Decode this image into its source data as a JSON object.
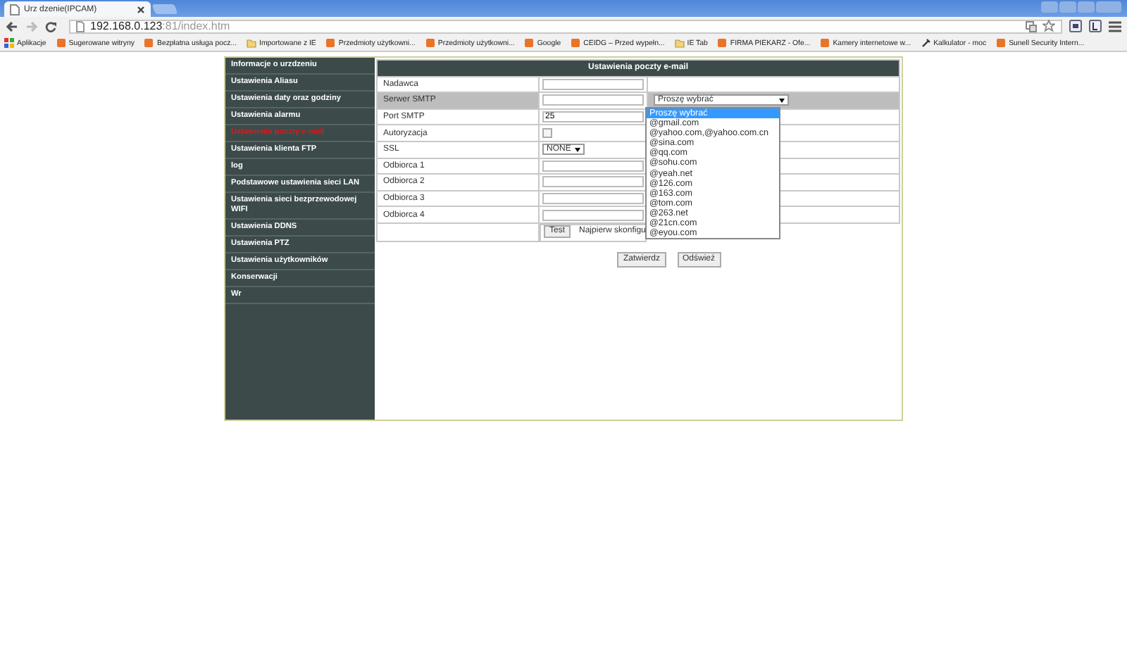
{
  "browser": {
    "tab_title": "Urz dzenie(IPCAM)",
    "url_host": "192.168.0.123",
    "url_rest": ":81/index.htm",
    "bookmarks": [
      {
        "kind": "apps",
        "label": "Aplikacje"
      },
      {
        "kind": "site",
        "label": "Sugerowane witryny"
      },
      {
        "kind": "site",
        "label": "Bezpłatna usługa pocz..."
      },
      {
        "kind": "folder",
        "label": "Importowane z IE"
      },
      {
        "kind": "site",
        "label": "Przedmioty użytkowni..."
      },
      {
        "kind": "site",
        "label": "Przedmioty użytkowni..."
      },
      {
        "kind": "site",
        "label": "Google"
      },
      {
        "kind": "site",
        "label": "CEIDG – Przed wypełn..."
      },
      {
        "kind": "folder",
        "label": "IE Tab"
      },
      {
        "kind": "site",
        "label": "FIRMA PIEKARZ - Ofe..."
      },
      {
        "kind": "site",
        "label": "Kamery internetowe w..."
      },
      {
        "kind": "tool",
        "label": "Kalkulator - moc"
      },
      {
        "kind": "site",
        "label": "Sunell Security Intern..."
      }
    ]
  },
  "sidebar": {
    "items": [
      {
        "label": "Informacje o urzdzeniu",
        "selected": false
      },
      {
        "label": "Ustawienia Aliasu",
        "selected": false
      },
      {
        "label": "Ustawienia daty oraz godziny",
        "selected": false
      },
      {
        "label": "Ustawienia alarmu",
        "selected": false
      },
      {
        "label": "Ustawienia poczty e-mail",
        "selected": true
      },
      {
        "label": "Ustawienia klienta FTP",
        "selected": false
      },
      {
        "label": "log",
        "selected": false
      },
      {
        "label": "Podstawowe ustawienia sieci LAN",
        "selected": false
      },
      {
        "label": "Ustawienia sieci bezprzewodowej WIFI",
        "selected": false
      },
      {
        "label": "Ustawienia DDNS",
        "selected": false
      },
      {
        "label": "Ustawienia PTZ",
        "selected": false
      },
      {
        "label": "Ustawienia użytkowników",
        "selected": false
      },
      {
        "label": "Konserwacji",
        "selected": false
      },
      {
        "label": "Wr",
        "selected": false
      }
    ]
  },
  "form": {
    "title": "Ustawienia poczty e-mail",
    "rows": [
      {
        "kind": "text",
        "label": "Nadawca",
        "value": ""
      },
      {
        "kind": "text",
        "label": "Serwer SMTP",
        "value": "",
        "highlighted": true
      },
      {
        "kind": "text",
        "label": "Port SMTP",
        "value": "25"
      },
      {
        "kind": "checkbox",
        "label": "Autoryzacja",
        "checked": false
      },
      {
        "kind": "select",
        "label": "SSL",
        "value": "NONE"
      },
      {
        "kind": "text",
        "label": "Odbiorca 1",
        "value": ""
      },
      {
        "kind": "text",
        "label": "Odbiorca 2",
        "value": ""
      },
      {
        "kind": "text",
        "label": "Odbiorca 3",
        "value": ""
      },
      {
        "kind": "text",
        "label": "Odbiorca 4",
        "value": ""
      }
    ],
    "test_button": "Test",
    "test_note": "Najpierw skonfigu",
    "smtp_dropdown": {
      "value": "Proszę wybrać",
      "options": [
        {
          "label": "Proszę wybrać",
          "selected": true
        },
        {
          "label": "@gmail.com",
          "selected": false
        },
        {
          "label": "@yahoo.com,@yahoo.com.cn",
          "selected": false
        },
        {
          "label": "@sina.com",
          "selected": false
        },
        {
          "label": "@qq.com",
          "selected": false
        },
        {
          "label": "@sohu.com",
          "selected": false
        },
        {
          "label": "@yeah.net",
          "selected": false
        },
        {
          "label": "@126.com",
          "selected": false
        },
        {
          "label": "@163.com",
          "selected": false
        },
        {
          "label": "@tom.com",
          "selected": false
        },
        {
          "label": "@263.net",
          "selected": false
        },
        {
          "label": "@21cn.com",
          "selected": false
        },
        {
          "label": "@eyou.com",
          "selected": false
        }
      ]
    },
    "buttons": [
      "Zatwierdz",
      "Odświeź"
    ]
  }
}
